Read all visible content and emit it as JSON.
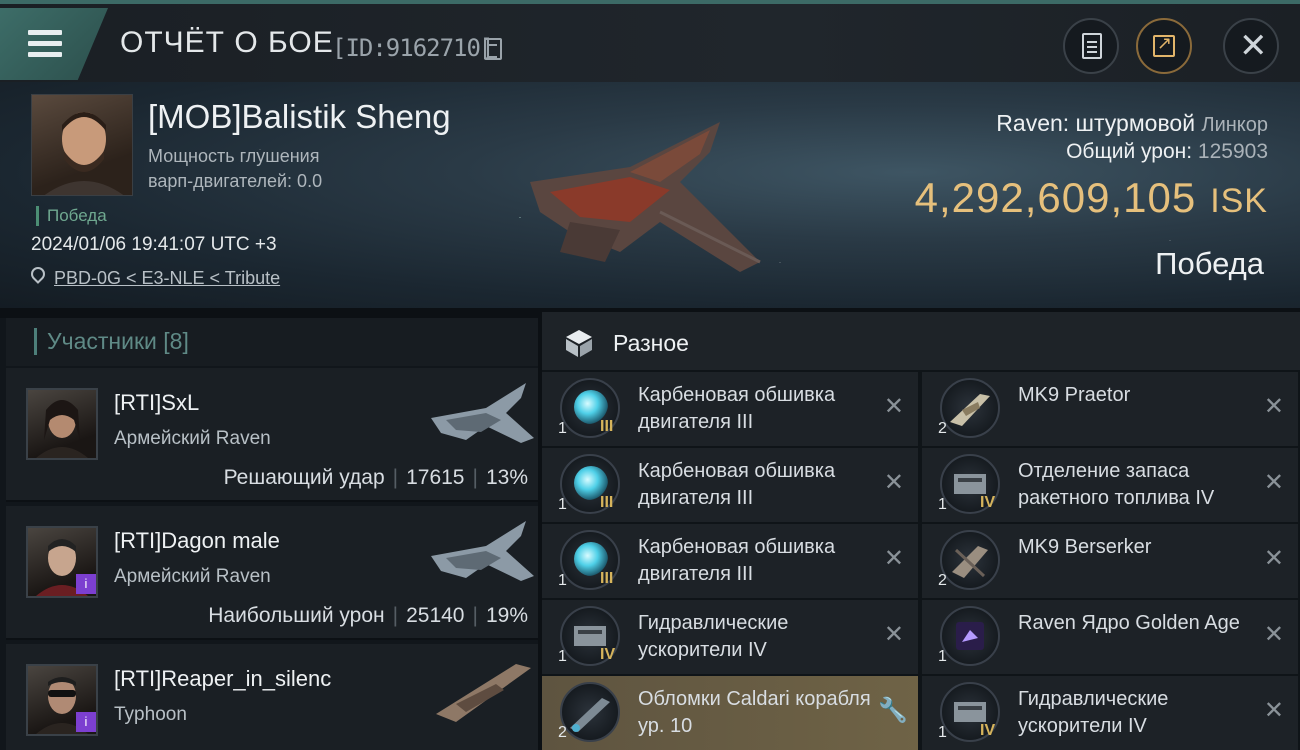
{
  "header": {
    "title": "ОТЧЁТ О БОЕ",
    "report_id": "[ID:9162710]",
    "icons": {
      "menu": "hamburger-menu-icon",
      "copy": "copy-icon",
      "clipboard": "clipboard-icon",
      "share": "share-icon",
      "close": "close-icon"
    }
  },
  "victim": {
    "name": "[MOB]Balistik Sheng",
    "jam_label_1": "Мощность глушения",
    "jam_label_2": "варп-двигателей: 0.0",
    "outcome_tag": "Победа",
    "datetime": "2024/01/06 19:41:07 UTC +3",
    "location": "PBD-0G < E3-NLE < Tribute",
    "ship_line": "Raven: штурмовой",
    "ship_class": "Линкор",
    "total_damage_label": "Общий урон:",
    "total_damage": "125903",
    "isk_value": "4,292,609,105",
    "isk_unit": "ISK",
    "outcome": "Победа"
  },
  "participants": {
    "title": "Участники [8]",
    "list": [
      {
        "name": "[RTI]SxL",
        "ship": "Армейский Raven",
        "role": "Решающий удар",
        "damage": "17615",
        "percent": "13%",
        "badge": ""
      },
      {
        "name": "[RTI]Dagon male",
        "ship": "Армейский Raven",
        "role": "Наибольший урон",
        "damage": "25140",
        "percent": "19%",
        "badge": "i"
      },
      {
        "name": "[RTI]Reaper_in_silenc",
        "ship": "Typhoon",
        "role": "",
        "damage": "",
        "percent": "",
        "badge": "i"
      }
    ]
  },
  "items": {
    "title": "Разное",
    "left": [
      {
        "name": "Карбеновая обшивка двигателя III",
        "qty": "1",
        "meta": "III"
      },
      {
        "name": "Карбеновая обшивка двигателя III",
        "qty": "1",
        "meta": "III"
      },
      {
        "name": "Карбеновая обшивка двигателя III",
        "qty": "1",
        "meta": "III"
      },
      {
        "name": "Гидравлические ускорители IV",
        "qty": "1",
        "meta": "IV"
      },
      {
        "name": "Обломки Caldari корабля ур. 10",
        "qty": "2",
        "meta": ""
      }
    ],
    "right": [
      {
        "name": "MK9  Praetor",
        "qty": "2",
        "meta": ""
      },
      {
        "name": "Отделение запаса ракетного топлива IV",
        "qty": "1",
        "meta": "IV"
      },
      {
        "name": "MK9  Berserker",
        "qty": "2",
        "meta": ""
      },
      {
        "name": "Raven Ядро Golden Age",
        "qty": "1",
        "meta": ""
      },
      {
        "name": "Гидравлические ускорители IV",
        "qty": "1",
        "meta": "IV"
      }
    ]
  }
}
